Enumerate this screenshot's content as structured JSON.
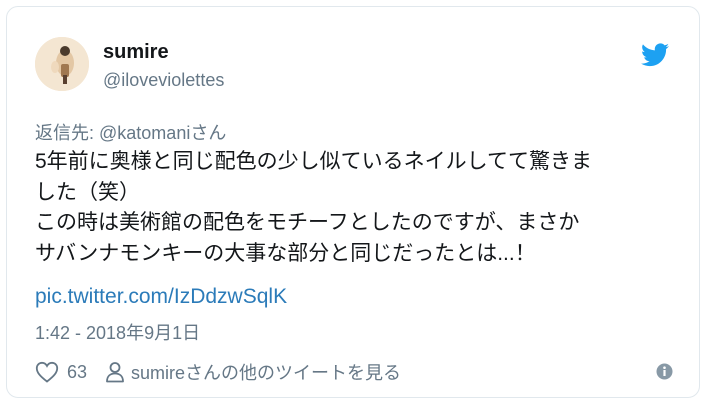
{
  "user": {
    "name": "sumire",
    "handle": "@iloveviolettes"
  },
  "reply": {
    "prefix": "返信先: ",
    "mention": "@katomani",
    "suffix": "さん"
  },
  "tweet": {
    "lines": [
      "5年前に奥様と同じ配色の少し似ているネイルしてて驚きま",
      "した（笑）",
      "この時は美術館の配色をモチーフとしたのですが、まさか",
      "サバンナモンキーの大事な部分と同じだったとは...！"
    ],
    "link": "pic.twitter.com/IzDdzwSqlK",
    "timestamp": "1:42 - 2018年9月1日"
  },
  "actions": {
    "like_count": "63",
    "more_tweets": "sumireさんの他のツイートを見る"
  },
  "colors": {
    "brand": "#1da1f2",
    "link": "#2b7bb9",
    "muted": "#657786",
    "text": "#14171a"
  },
  "icons": [
    "avatar",
    "twitter-bird-icon",
    "heart-icon",
    "person-icon",
    "info-icon"
  ]
}
